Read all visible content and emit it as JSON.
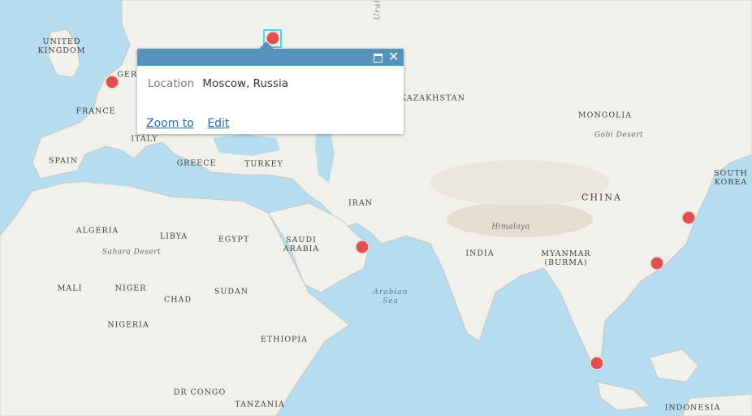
{
  "map": {
    "labels": {
      "uk": "UNITED\nKINGDOM",
      "germany": "GERM",
      "france": "FRANCE",
      "spain": "SPAIN",
      "italy": "ITALY",
      "greece": "GREECE",
      "turkey": "TURKEY",
      "ural": "Ural",
      "kazakhstan": "KAZAKHSTAN",
      "mongolia": "MONGOLIA",
      "gobi": "Gobi Desert",
      "south_korea": "SOUTH\nKOREA",
      "china": "CHINA",
      "iran": "IRAN",
      "himalaya": "Himalaya",
      "algeria": "ALGERIA",
      "libya": "LIBYA",
      "egypt": "EGYPT",
      "saudi": "SAUDI\nARABIA",
      "sahara": "Sahara Desert",
      "india": "INDIA",
      "myanmar": "MYANMAR\n(BURMA)",
      "mali": "MALI",
      "niger": "NIGER",
      "chad": "CHAD",
      "sudan": "SUDAN",
      "arabian_sea": "Arabian\nSea",
      "nigeria": "NIGERIA",
      "ethiopia": "ETHIOPIA",
      "dr_congo": "DR CONGO",
      "tanzania": "TANZANIA",
      "indonesia": "INDONESIA"
    },
    "markers": [
      {
        "name": "moscow",
        "selected": true
      },
      {
        "name": "paris",
        "selected": false
      },
      {
        "name": "dubai",
        "selected": false
      },
      {
        "name": "shanghai",
        "selected": false
      },
      {
        "name": "hong-kong",
        "selected": false
      },
      {
        "name": "singapore",
        "selected": false
      }
    ],
    "colors": {
      "water": "#b6dcef",
      "land": "#f2f0ea",
      "marker": "#e05050",
      "popup_header": "#5393bc",
      "selection": "#4ad6f0"
    }
  },
  "popup": {
    "field_name": "Location",
    "field_value": "Moscow, Russia",
    "zoom_label": "Zoom to",
    "edit_label": "Edit",
    "maximize_icon": "maximize-icon",
    "close_icon": "close-icon",
    "close_glyph": "✕"
  }
}
